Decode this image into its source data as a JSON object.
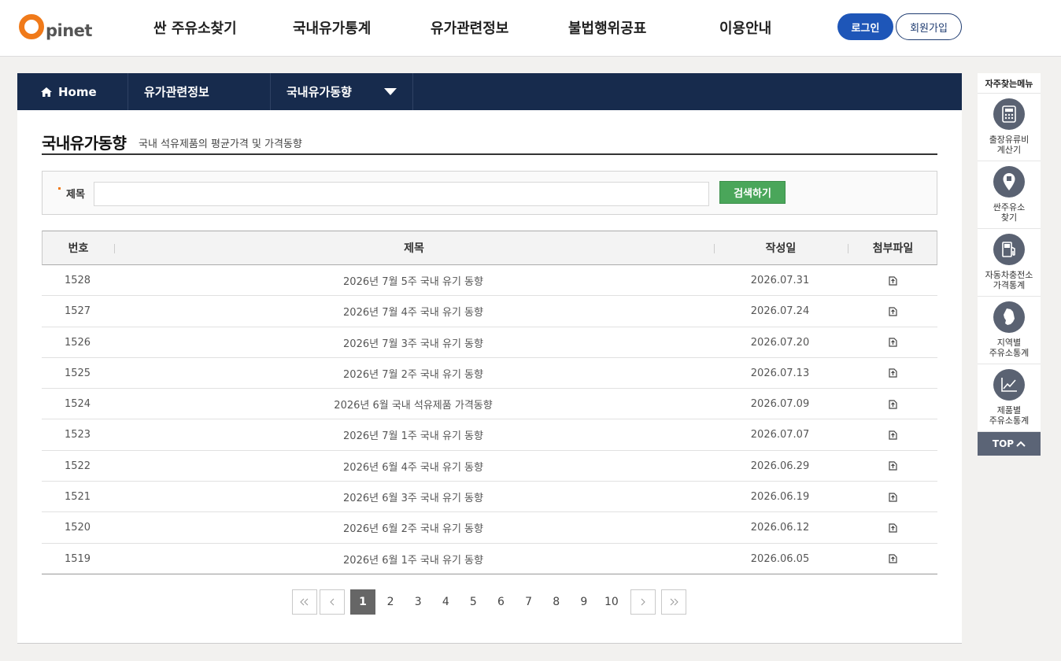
{
  "brand": {
    "logo_text": "pinet",
    "logo_color": "#f07a1a"
  },
  "gnb": [
    {
      "label": "싼 주유소찾기"
    },
    {
      "label": "국내유가통계"
    },
    {
      "label": "유가관련정보"
    },
    {
      "label": "불법행위공표"
    },
    {
      "label": "이용안내"
    }
  ],
  "auth": {
    "login_label": "로그인",
    "join_label": "회원가입"
  },
  "breadcrumb": {
    "home": "Home",
    "level1": "유가관련정보",
    "level2": "국내유가동향"
  },
  "page": {
    "title": "국내유가동향",
    "description": "국내 석유제품의 평균가격 및 가격동향"
  },
  "search": {
    "label": "제목",
    "value": "",
    "placeholder": "",
    "button_label": "검색하기"
  },
  "table": {
    "headers": {
      "no": "번호",
      "title": "제목",
      "date": "작성일",
      "file": "첨부파일"
    },
    "rows": [
      {
        "no": "1528",
        "title": "2026년 7월 5주 국내 유기 동향",
        "date": "2026.07.31"
      },
      {
        "no": "1527",
        "title": "2026년 7월 4주 국내 유기 동향",
        "date": "2026.07.24"
      },
      {
        "no": "1526",
        "title": "2026년 7월 3주 국내 유기 동향",
        "date": "2026.07.20"
      },
      {
        "no": "1525",
        "title": "2026년 7월 2주 국내 유기 동향",
        "date": "2026.07.13"
      },
      {
        "no": "1524",
        "title": "2026년 6월 국내 석유제품 가격동향",
        "date": "2026.07.09"
      },
      {
        "no": "1523",
        "title": "2026년 7월 1주 국내 유기 동향",
        "date": "2026.07.07"
      },
      {
        "no": "1522",
        "title": "2026년 6월 4주 국내 유기 동향",
        "date": "2026.06.29"
      },
      {
        "no": "1521",
        "title": "2026년 6월 3주 국내 유기 동향",
        "date": "2026.06.19"
      },
      {
        "no": "1520",
        "title": "2026년 6월 2주 국내 유기 동향",
        "date": "2026.06.12"
      },
      {
        "no": "1519",
        "title": "2026년 6월 1주 국내 유기 동향",
        "date": "2026.06.05"
      }
    ]
  },
  "pagination": {
    "pages": [
      "1",
      "2",
      "3",
      "4",
      "5",
      "6",
      "7",
      "8",
      "9",
      "10"
    ],
    "current": "1"
  },
  "quick_menu": {
    "title": "자주찾는메뉴",
    "items": [
      {
        "label": "출장유류비\n계산기",
        "icon": "calculator-icon"
      },
      {
        "label": "싼주유소\n찾기",
        "icon": "location-pin-icon"
      },
      {
        "label": "자동차충전소\n가격통계",
        "icon": "fuel-pump-icon"
      },
      {
        "label": "지역별\n주유소통계",
        "icon": "korea-map-icon"
      },
      {
        "label": "제품별\n주유소통계",
        "icon": "line-chart-icon"
      }
    ],
    "top_label": "TOP"
  },
  "colors": {
    "nav_bg": "#172b4d",
    "login_bg": "#1e56b8",
    "search_btn": "#4aa65a",
    "quick_bg": "#5a6272"
  }
}
